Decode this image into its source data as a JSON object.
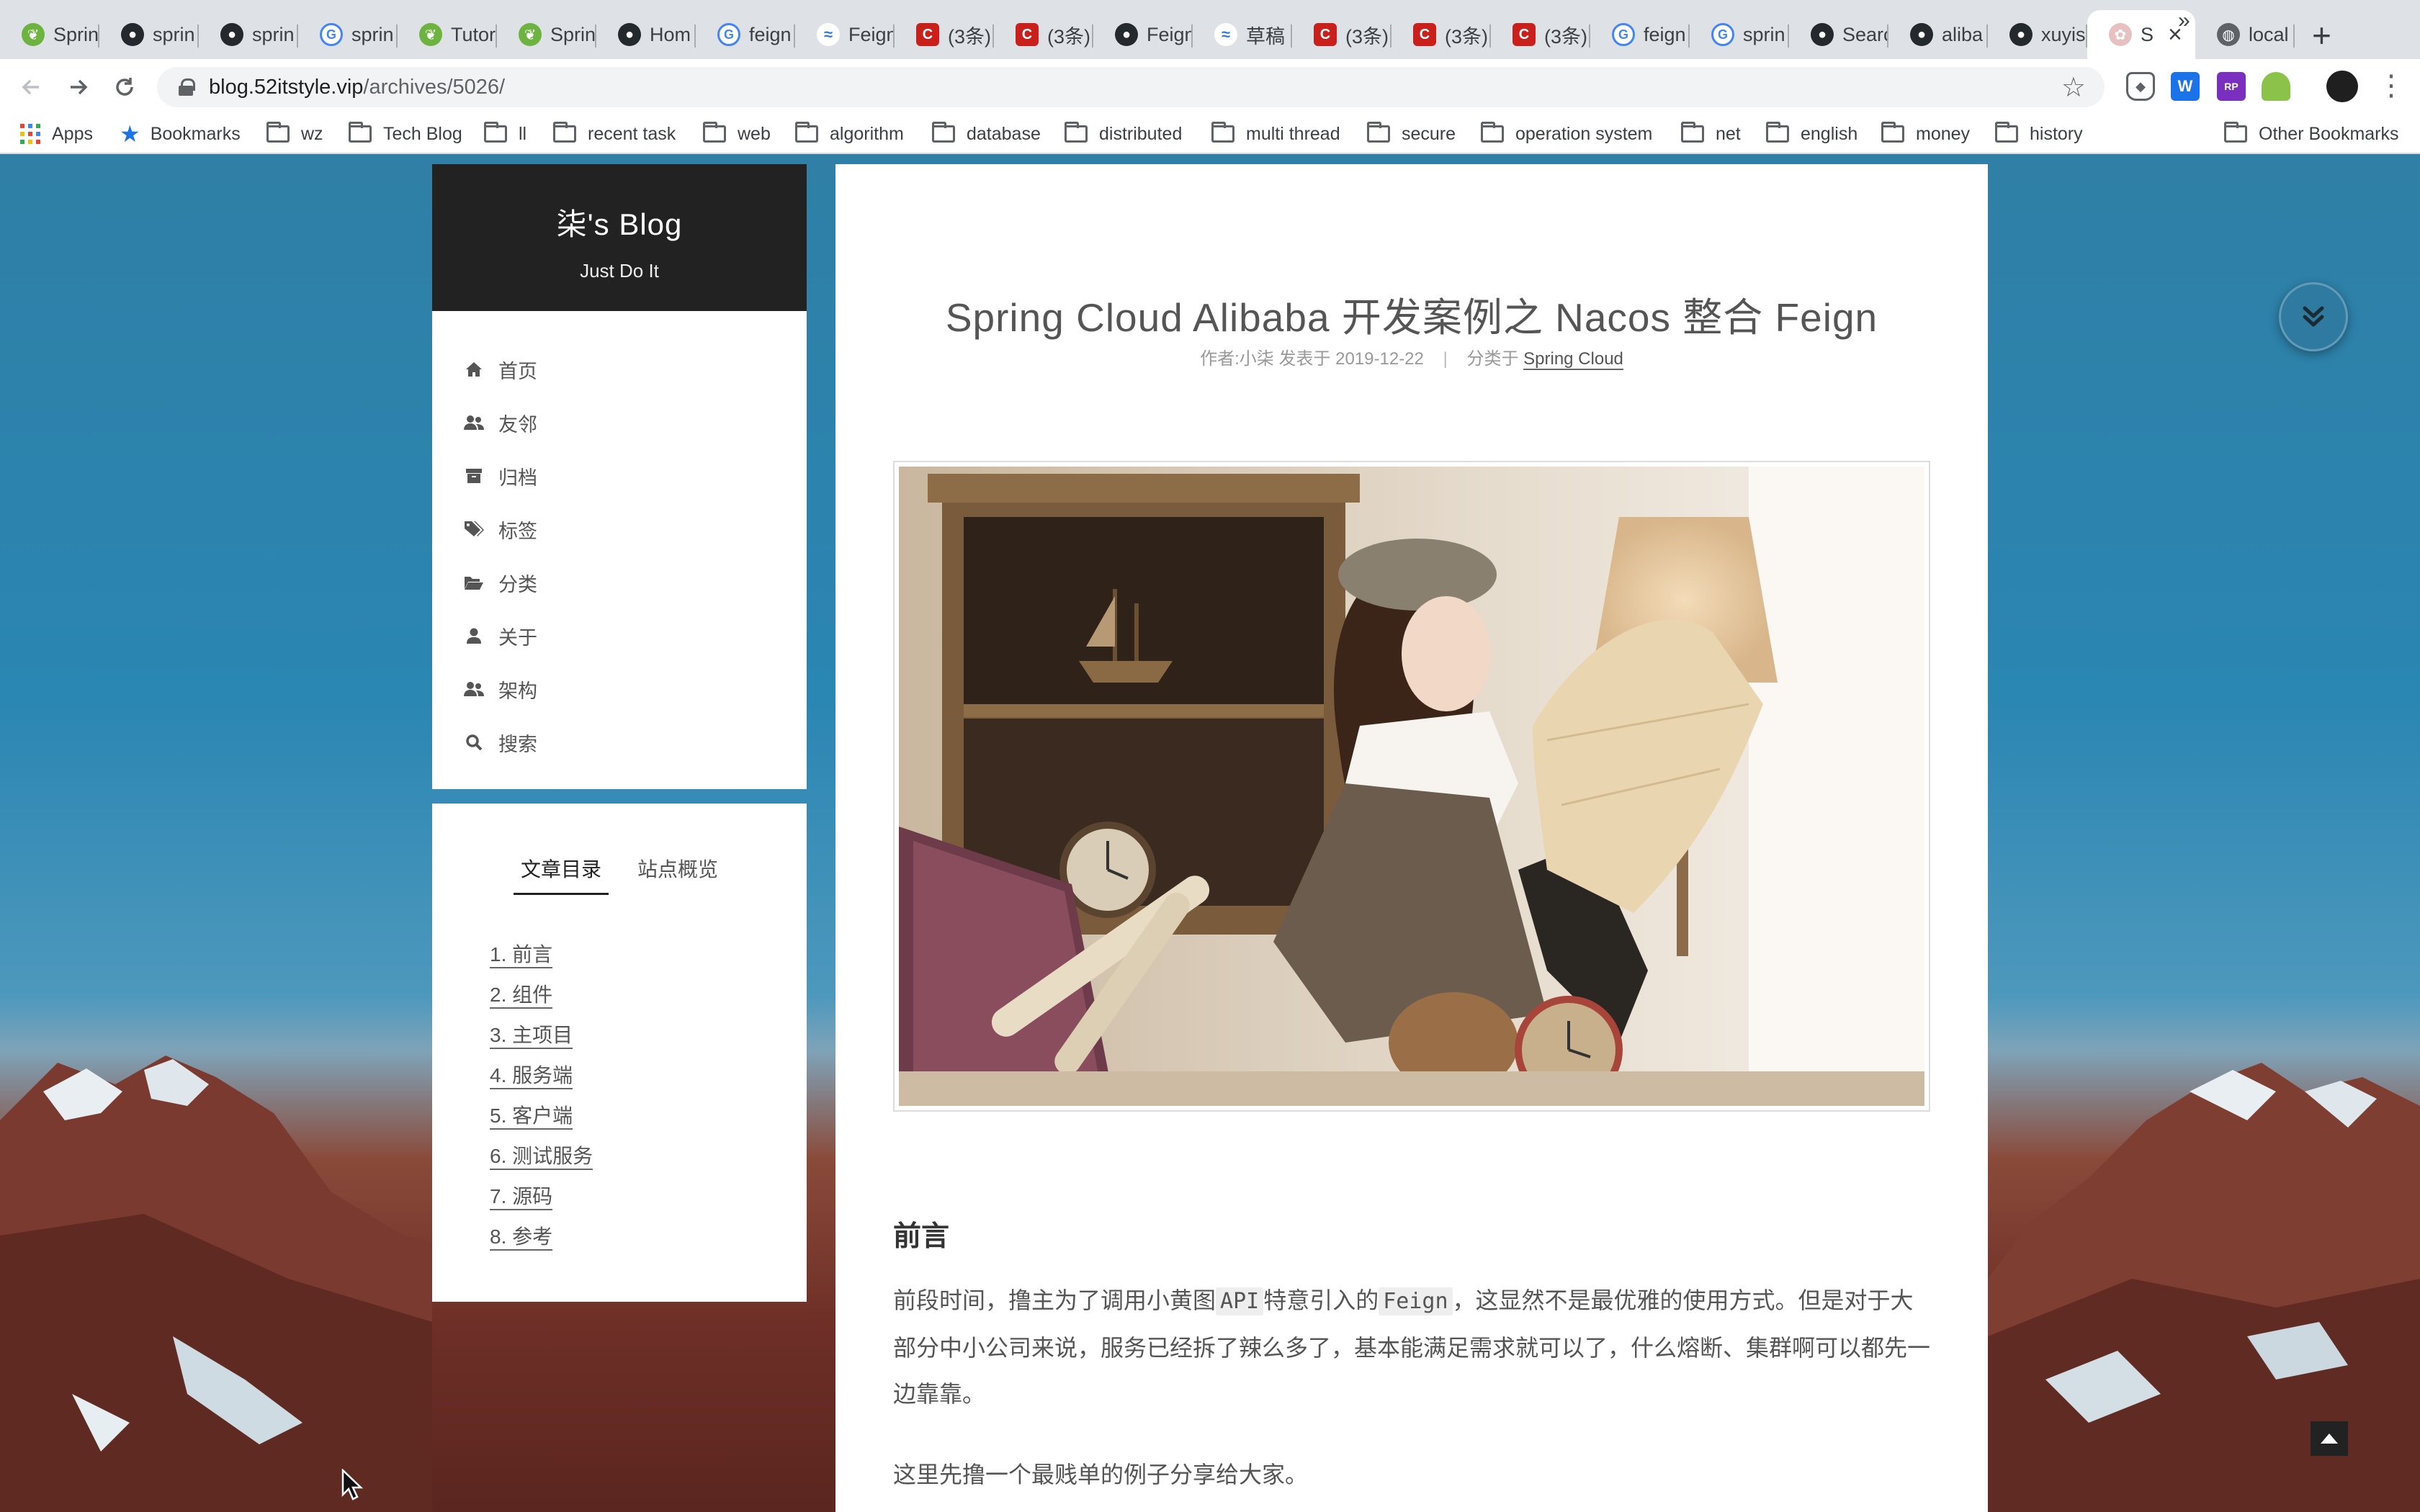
{
  "browser": {
    "tabs": [
      {
        "title": "Sprin",
        "icon": "spring-icon"
      },
      {
        "title": "sprin",
        "icon": "github-icon"
      },
      {
        "title": "sprin",
        "icon": "github-icon"
      },
      {
        "title": "sprin",
        "icon": "google-icon"
      },
      {
        "title": "Tutor",
        "icon": "spring-icon"
      },
      {
        "title": "Sprin",
        "icon": "spring-icon"
      },
      {
        "title": "Hom",
        "icon": "github-icon"
      },
      {
        "title": "feign",
        "icon": "google-icon"
      },
      {
        "title": "Feign",
        "icon": "yuque-icon"
      },
      {
        "title": "(3条)",
        "icon": "csdn-icon"
      },
      {
        "title": "(3条)",
        "icon": "csdn-icon"
      },
      {
        "title": "Feign",
        "icon": "github-icon"
      },
      {
        "title": "草稿",
        "icon": "yuque-icon"
      },
      {
        "title": "(3条)",
        "icon": "csdn-icon"
      },
      {
        "title": "(3条)",
        "icon": "csdn-icon"
      },
      {
        "title": "(3条)",
        "icon": "csdn-icon"
      },
      {
        "title": "feign",
        "icon": "google-icon"
      },
      {
        "title": "sprin",
        "icon": "google-icon"
      },
      {
        "title": "Searc",
        "icon": "github-icon"
      },
      {
        "title": "aliba",
        "icon": "github-icon"
      },
      {
        "title": "xuyis",
        "icon": "github-icon"
      },
      {
        "title": "S",
        "icon": "blog-icon",
        "active": true
      },
      {
        "title": "local",
        "icon": "globe-icon"
      }
    ],
    "url_host": "blog.52itstyle.vip",
    "url_path": "/archives/5026/",
    "bookmarks": [
      {
        "label": "Apps",
        "type": "apps"
      },
      {
        "label": "Bookmarks",
        "type": "star"
      },
      {
        "label": "wz",
        "type": "folder"
      },
      {
        "label": "Tech Blog",
        "type": "folder"
      },
      {
        "label": "ll",
        "type": "folder"
      },
      {
        "label": "recent task",
        "type": "folder"
      },
      {
        "label": "web",
        "type": "folder"
      },
      {
        "label": "algorithm",
        "type": "folder"
      },
      {
        "label": "database",
        "type": "folder"
      },
      {
        "label": "distributed",
        "type": "folder"
      },
      {
        "label": "multi thread",
        "type": "folder"
      },
      {
        "label": "secure",
        "type": "folder"
      },
      {
        "label": "operation system",
        "type": "folder"
      },
      {
        "label": "net",
        "type": "folder"
      },
      {
        "label": "english",
        "type": "folder"
      },
      {
        "label": "money",
        "type": "folder"
      },
      {
        "label": "history",
        "type": "folder"
      }
    ],
    "bookmarks_more": "»",
    "other_bookmarks": "Other Bookmarks",
    "extension_w_label": "W",
    "extension_rp_label": "RP"
  },
  "site": {
    "title": "柒's Blog",
    "subtitle": "Just Do It"
  },
  "menu": [
    {
      "label": "首页",
      "icon": "home-icon"
    },
    {
      "label": "友邻",
      "icon": "users-icon"
    },
    {
      "label": "归档",
      "icon": "archive-icon"
    },
    {
      "label": "标签",
      "icon": "tags-icon"
    },
    {
      "label": "分类",
      "icon": "folder-open-icon"
    },
    {
      "label": "关于",
      "icon": "user-icon"
    },
    {
      "label": "架构",
      "icon": "users-icon"
    },
    {
      "label": "搜索",
      "icon": "search-icon"
    }
  ],
  "toc": {
    "tabs": [
      "文章目录",
      "站点概览"
    ],
    "active_tab": 0,
    "items": [
      "1. 前言",
      "2. 组件",
      "3. 主项目",
      "4. 服务端",
      "5. 客户端",
      "6. 测试服务",
      "7. 源码",
      "8. 参考"
    ]
  },
  "post": {
    "title": "Spring Cloud Alibaba 开发案例之 Nacos 整合 Feign",
    "meta_author": "作者:小柒 发表于 2019-12-22",
    "meta_divider": "|",
    "meta_cat_prefix": "分类于",
    "meta_category": "Spring Cloud",
    "heading": "前言",
    "p1_a": "前段时间，撸主为了调用小黄图",
    "p1_code1": "API",
    "p1_b": "特意引入的",
    "p1_code2": "Feign",
    "p1_c": "，这显然不是最优雅的使用方式。但是对于大部分中小公司来说，服务已经拆了辣么多了，基本能满足需求就可以了，什么熔断、集群啊可以都先一边靠靠。",
    "p2": "这里先撸一个最贱单的例子分享给大家。"
  },
  "colors": {
    "accent": "#222222",
    "page_bg": "#2f7fa6",
    "float_button": "#2e7aa0"
  }
}
